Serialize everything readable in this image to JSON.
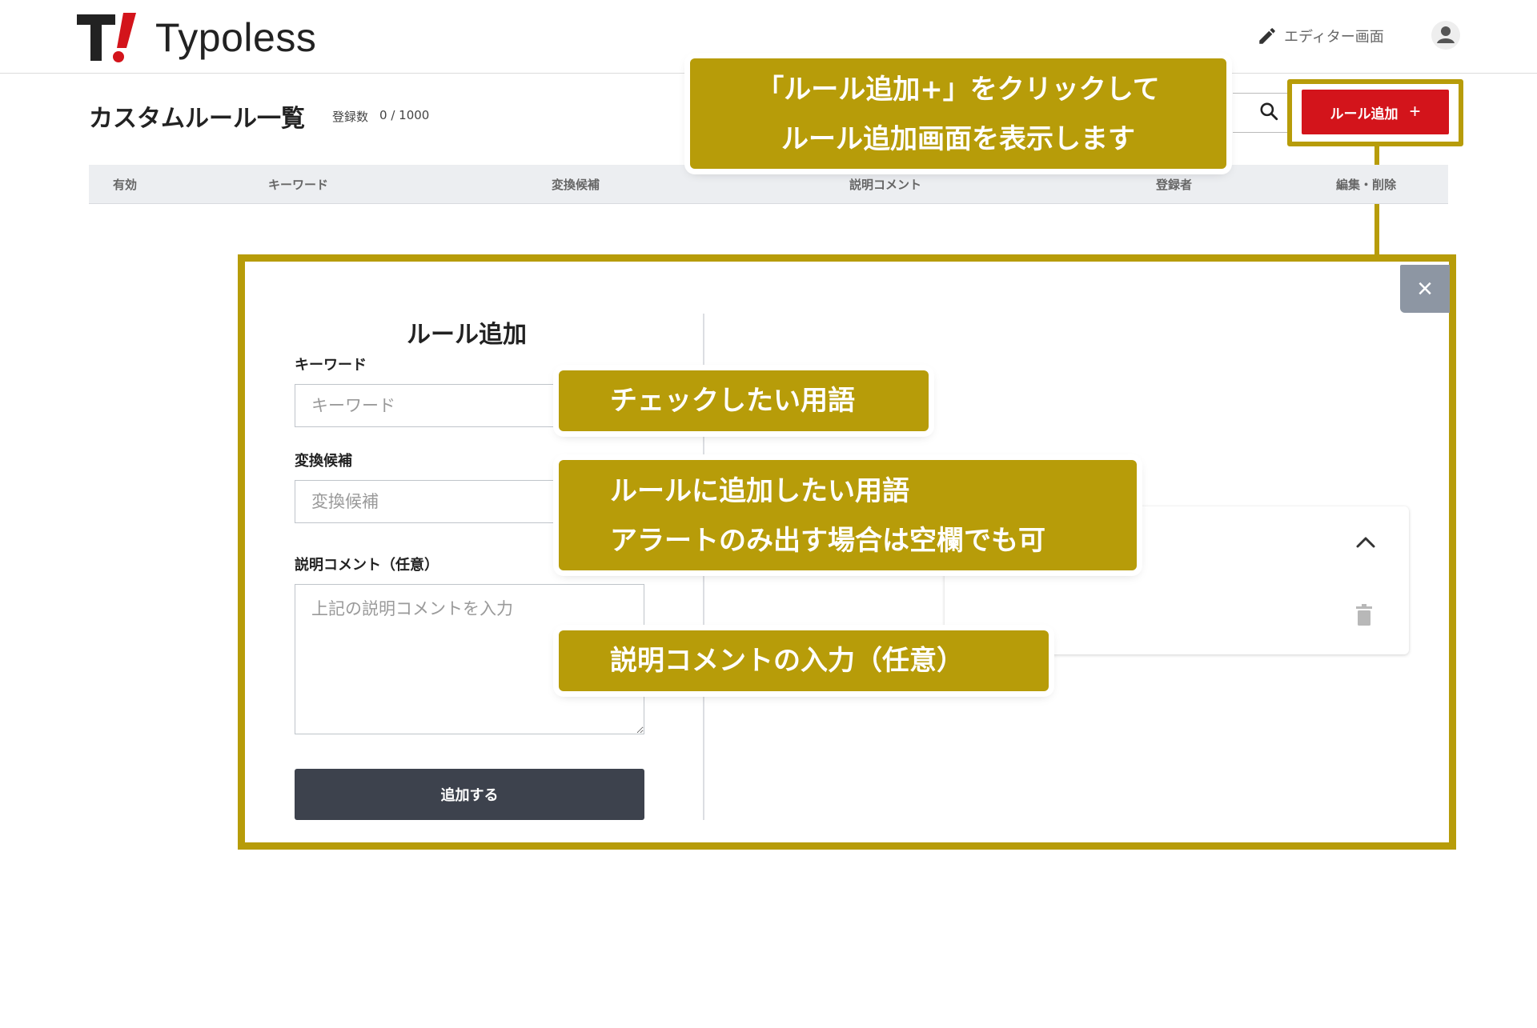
{
  "app": {
    "logo_text": "Typoless"
  },
  "header": {
    "editor_link_label": "エディター画面"
  },
  "page": {
    "title": "カスタムルール一覧",
    "count_label": "登録数",
    "count_value": "0 / 1000"
  },
  "toolbar": {
    "add_rule_label": "ルール追加",
    "add_rule_plus": "+"
  },
  "table": {
    "columns": [
      "有効",
      "キーワード",
      "変換候補",
      "説明コメント",
      "登録者",
      "編集・削除"
    ]
  },
  "modal": {
    "title": "ルール追加",
    "close_glyph": "×",
    "keyword_label": "キーワード",
    "keyword_placeholder": "キーワード",
    "candidate_label": "変換候補",
    "candidate_placeholder": "変換候補",
    "comment_label": "説明コメント（任意）",
    "comment_placeholder": "上記の説明コメントを入力",
    "submit_label": "追加する"
  },
  "callouts": {
    "add_rule_line1": "「ルール追加+」をクリックして",
    "add_rule_line2": "ルール追加画面を表示します",
    "keyword": "チェックしたい用語",
    "candidate_line1": "ルールに追加したい用語",
    "candidate_line2": "アラートのみ出す場合は空欄でも可",
    "comment": "説明コメントの入力（任意）"
  },
  "colors": {
    "accent_red": "#d3141b",
    "callout_gold": "#b79c09",
    "submit_dark": "#3d424d",
    "close_gray": "#8d96a3"
  },
  "icons": [
    "typoless-logo-icon",
    "pencil-icon",
    "user-icon",
    "search-icon",
    "plus-icon",
    "close-icon",
    "chevron-up-icon",
    "trash-icon"
  ]
}
